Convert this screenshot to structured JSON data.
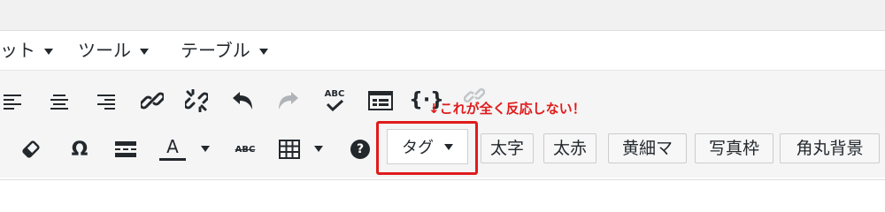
{
  "menubar": {
    "items": [
      {
        "label": "ット"
      },
      {
        "label": "ツール"
      },
      {
        "label": "テーブル"
      }
    ]
  },
  "toolbar": {
    "row1": [
      "align-left",
      "align-center",
      "align-right",
      "insert-link",
      "unlink",
      "undo",
      "redo",
      "spellcheck",
      "code-sample",
      "code-braces",
      "link-disabled"
    ],
    "row2": [
      "clear-formatting",
      "special-character",
      "page-break",
      "text-color",
      "strikethrough",
      "table",
      "help"
    ],
    "special_character_glyph": "Ω",
    "text_color_letter": "A",
    "text_color_bar": "#23282d",
    "strikethrough_label": "ABC",
    "spellcheck_label": "ABC",
    "help_glyph": "?"
  },
  "tag_dropdown": {
    "label": "タグ"
  },
  "annotation": {
    "arrow": "↓",
    "text": "これが全く反応しない！",
    "color": "#e01b1b"
  },
  "quicktags": [
    {
      "label": "太字"
    },
    {
      "label": "太赤"
    },
    {
      "label": "黄細マ"
    },
    {
      "label": "写真枠"
    },
    {
      "label": "角丸背景"
    }
  ]
}
